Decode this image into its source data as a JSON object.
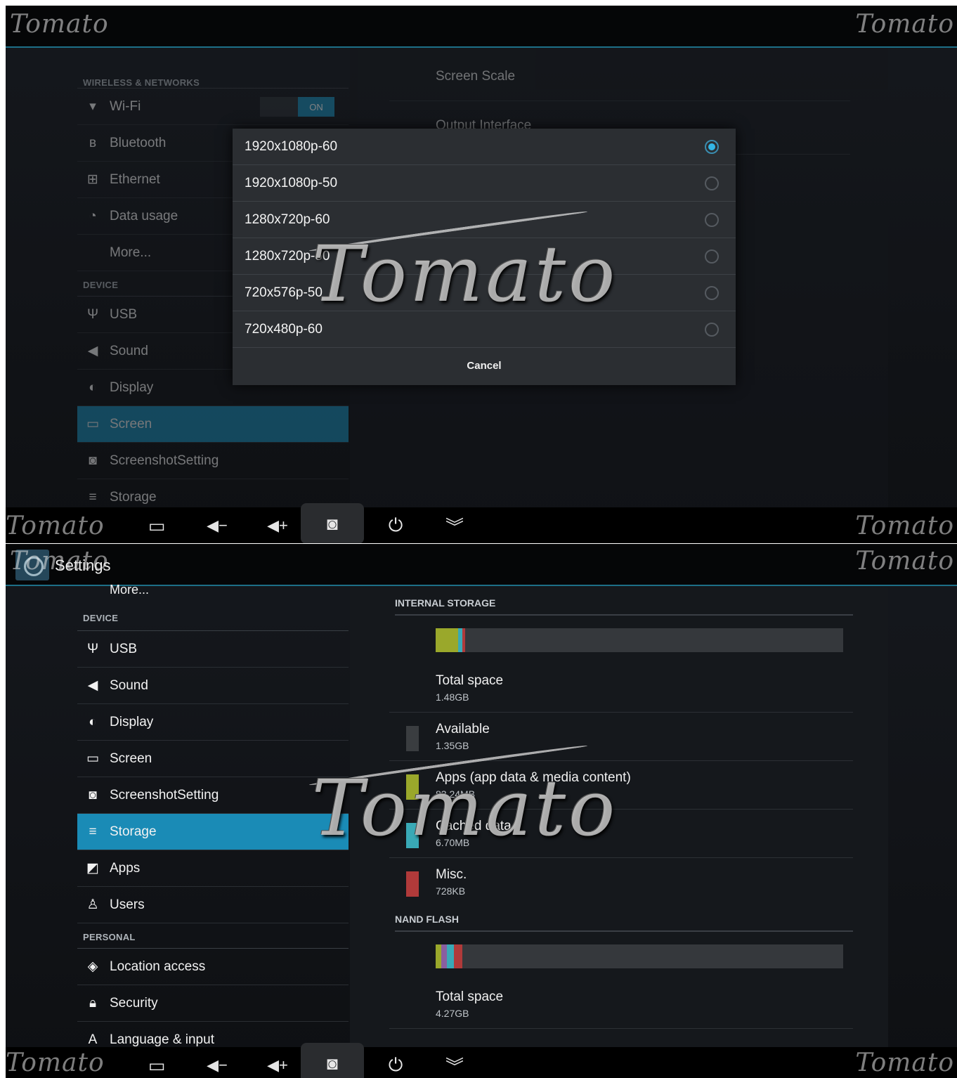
{
  "watermark": "Tomato",
  "top_screen": {
    "wireless_header": "WIRELESS & NETWORKS",
    "device_header": "DEVICE",
    "items": [
      {
        "label": "Wi-Fi",
        "icon": "wifi-icon"
      },
      {
        "label": "Bluetooth",
        "icon": "bluetooth-icon"
      },
      {
        "label": "Ethernet",
        "icon": "ethernet-icon"
      },
      {
        "label": "Data usage",
        "icon": "data-usage-icon"
      },
      {
        "label": "More..."
      },
      {
        "label": "USB",
        "icon": "usb-icon"
      },
      {
        "label": "Sound",
        "icon": "sound-icon"
      },
      {
        "label": "Display",
        "icon": "display-icon"
      },
      {
        "label": "Screen",
        "icon": "screen-icon"
      },
      {
        "label": "ScreenshotSetting",
        "icon": "camera-icon"
      },
      {
        "label": "Storage",
        "icon": "storage-icon"
      }
    ],
    "wifi_toggle": "ON",
    "right_prefs": [
      "Screen Scale",
      "Output Interface"
    ],
    "dialog": {
      "options": [
        "1920x1080p-60",
        "1920x1080p-50",
        "1280x720p-60",
        "1280x720p-50",
        "720x576p-50",
        "720x480p-60"
      ],
      "selected_index": 0,
      "cancel": "Cancel"
    }
  },
  "bottom_screen": {
    "title": "Settings",
    "more": "More...",
    "device_header": "DEVICE",
    "personal_header": "PERSONAL",
    "device_items": [
      {
        "label": "USB",
        "icon": "usb-icon"
      },
      {
        "label": "Sound",
        "icon": "sound-icon"
      },
      {
        "label": "Display",
        "icon": "display-icon"
      },
      {
        "label": "Screen",
        "icon": "screen-icon"
      },
      {
        "label": "ScreenshotSetting",
        "icon": "camera-icon"
      },
      {
        "label": "Storage",
        "icon": "storage-icon"
      },
      {
        "label": "Apps",
        "icon": "apps-icon"
      },
      {
        "label": "Users",
        "icon": "users-icon"
      }
    ],
    "personal_items": [
      {
        "label": "Location access",
        "icon": "location-icon"
      },
      {
        "label": "Security",
        "icon": "lock-icon"
      },
      {
        "label": "Language & input",
        "icon": "language-icon"
      }
    ],
    "storage": {
      "internal_header": "INTERNAL STORAGE",
      "nand_header": "NAND FLASH",
      "rows": [
        {
          "label": "Total space",
          "value": "1.48GB"
        },
        {
          "label": "Available",
          "value": "1.35GB",
          "color": "#3a3d40"
        },
        {
          "label": "Apps (app data & media content)",
          "value": "83.24MB",
          "color": "#9aa82b"
        },
        {
          "label": "Cached data",
          "value": "6.70MB",
          "color": "#39a9b6"
        },
        {
          "label": "Misc.",
          "value": "728KB",
          "color": "#b03a3a"
        }
      ],
      "nand_rows": [
        {
          "label": "Total space",
          "value": "4.27GB"
        }
      ]
    }
  },
  "navbar": {
    "buttons": [
      "recent-apps-icon",
      "volume-down-icon",
      "volume-up-icon",
      "screenshot-icon",
      "power-icon",
      "collapse-icon"
    ]
  }
}
